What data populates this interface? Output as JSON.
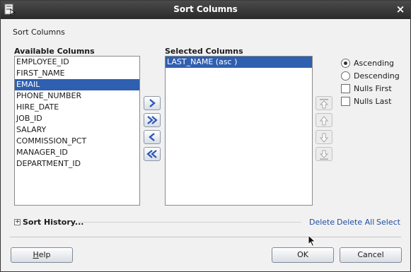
{
  "window": {
    "title": "Sort Columns",
    "close_glyph": "×"
  },
  "header": {
    "section_title": "Sort Columns"
  },
  "available": {
    "label": "Available Columns",
    "items": [
      "EMPLOYEE_ID",
      "FIRST_NAME",
      "EMAIL",
      "PHONE_NUMBER",
      "HIRE_DATE",
      "JOB_ID",
      "SALARY",
      "COMMISSION_PCT",
      "MANAGER_ID",
      "DEPARTMENT_ID"
    ],
    "selected_index": 2
  },
  "selected": {
    "label": "Selected Columns",
    "items": [
      "LAST_NAME (asc )"
    ],
    "selected_index": 0
  },
  "move_buttons": [
    "move-right-icon",
    "move-all-right-icon",
    "move-left-icon",
    "move-all-left-icon"
  ],
  "order_buttons": [
    "move-top-icon",
    "move-up-icon",
    "move-down-icon",
    "move-bottom-icon"
  ],
  "options": {
    "ascending": "Ascending",
    "descending": "Descending",
    "nulls_first": "Nulls First",
    "nulls_last": "Nulls Last",
    "sort_order": "ascending"
  },
  "history": {
    "label": "Sort History...",
    "delete": "Delete",
    "delete_all": "Delete All",
    "select": "Select"
  },
  "buttons": {
    "help_prefix": "",
    "help_mnemonic": "H",
    "help_rest": "elp",
    "ok": "OK",
    "cancel": "Cancel"
  },
  "colors": {
    "titlebar": "#2f2f2f",
    "selection": "#2f5fb0",
    "link": "#1f4ea0",
    "arrow": "#2e56b8"
  }
}
